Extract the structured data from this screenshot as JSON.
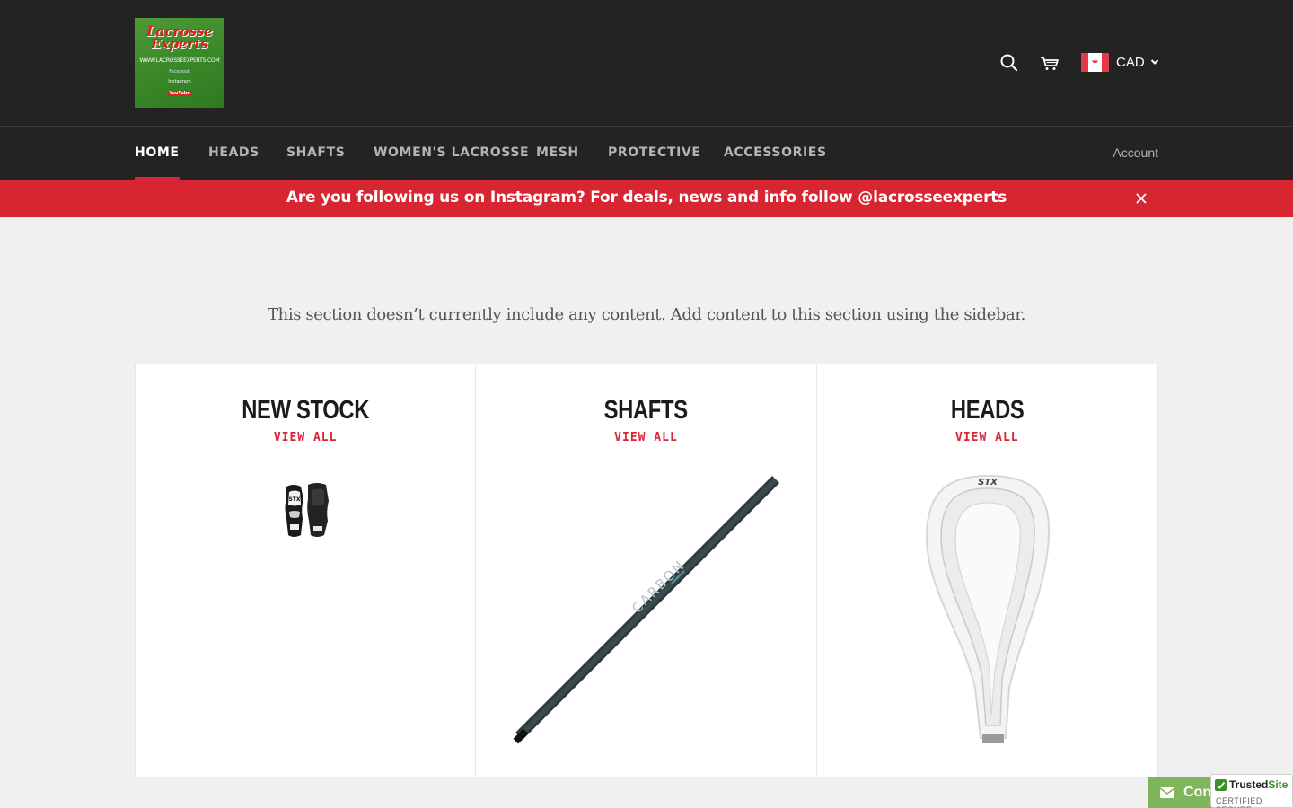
{
  "header": {
    "logo": {
      "title_line1": "Lacrosse",
      "title_line2": "Experts",
      "url": "WWW.LACROSSEEXPERTS.COM",
      "social1": "Facebook",
      "social2": "Instagram",
      "social3": "YouTube"
    },
    "search_icon": "search-icon",
    "cart_icon": "cart-icon",
    "currency": {
      "code": "CAD",
      "flag": "canada-flag"
    }
  },
  "nav": {
    "items": [
      {
        "label": "HOME",
        "active": true
      },
      {
        "label": "HEADS",
        "active": false
      },
      {
        "label": "SHAFTS",
        "active": false
      },
      {
        "label": "WOMEN'S LACROSSE",
        "active": false
      },
      {
        "label": "MESH",
        "active": false
      },
      {
        "label": "PROTECTIVE",
        "active": false
      },
      {
        "label": "ACCESSORIES",
        "active": false
      }
    ],
    "account_label": "Account"
  },
  "announcement": {
    "text": "Are you following us on Instagram? For deals, news and info follow @lacrosseexperts",
    "close_icon": "close-icon"
  },
  "empty_section": {
    "text": "This section doesn’t currently include any content. Add content to this section using the sidebar."
  },
  "collections": [
    {
      "title": "NEW STOCK",
      "link": "VIEW ALL",
      "image": "arm-guards-image"
    },
    {
      "title": "SHAFTS",
      "link": "VIEW ALL",
      "image": "lacrosse-shaft-image"
    },
    {
      "title": "HEADS",
      "link": "VIEW ALL",
      "image": "lacrosse-head-image"
    }
  ],
  "contact_widget": {
    "label": "Con",
    "icon": "envelope-icon"
  },
  "trusted_badge": {
    "title_a": "Trusted",
    "title_b": "Site",
    "subtitle": "CERTIFIED SECURE"
  },
  "colors": {
    "header_bg": "#232323",
    "accent_red": "#d72631",
    "page_bg": "#f0f0f0",
    "contact_green": "#7fb55b"
  }
}
